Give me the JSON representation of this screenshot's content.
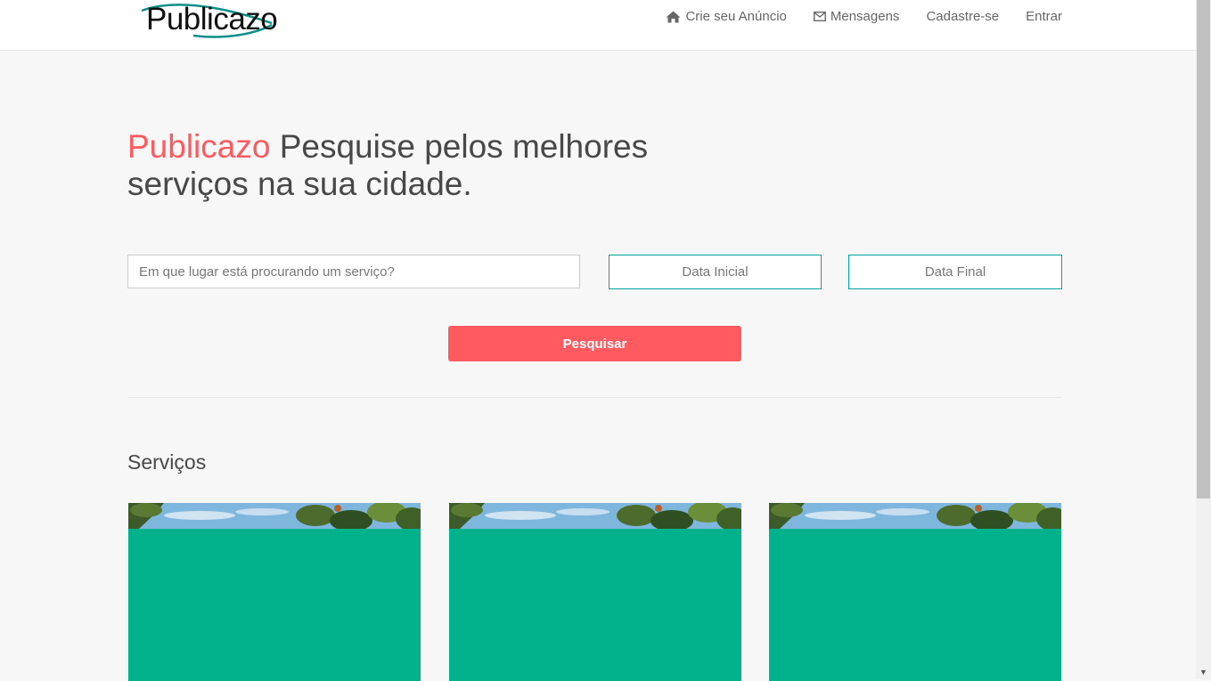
{
  "brand": {
    "logo_text": "Publicazo"
  },
  "nav": {
    "create_ad": "Crie seu Anúncio",
    "messages": "Mensagens",
    "signup": "Cadastre-se",
    "login": "Entrar"
  },
  "hero": {
    "brand": "Publicazo",
    "headline": "Pesquise pelos melhores serviços na sua cidade."
  },
  "search": {
    "location_placeholder": "Em que lugar está procurando um serviço?",
    "start_date_placeholder": "Data Inicial",
    "end_date_placeholder": "Data Final",
    "button_label": "Pesquisar"
  },
  "services": {
    "title": "Serviços",
    "cards": [
      {
        "image": "tropical-foliage-sky-photo"
      },
      {
        "image": "tropical-foliage-sky-photo"
      },
      {
        "image": "tropical-foliage-sky-photo"
      }
    ]
  },
  "colors": {
    "accent": "#ff5a5f",
    "teal": "#00a699",
    "card": "#00b28b",
    "background": "#f7f7f7"
  },
  "icons": {
    "create_ad": "home-icon",
    "messages": "envelope-icon",
    "scroll_down": "chevron-down-icon"
  }
}
